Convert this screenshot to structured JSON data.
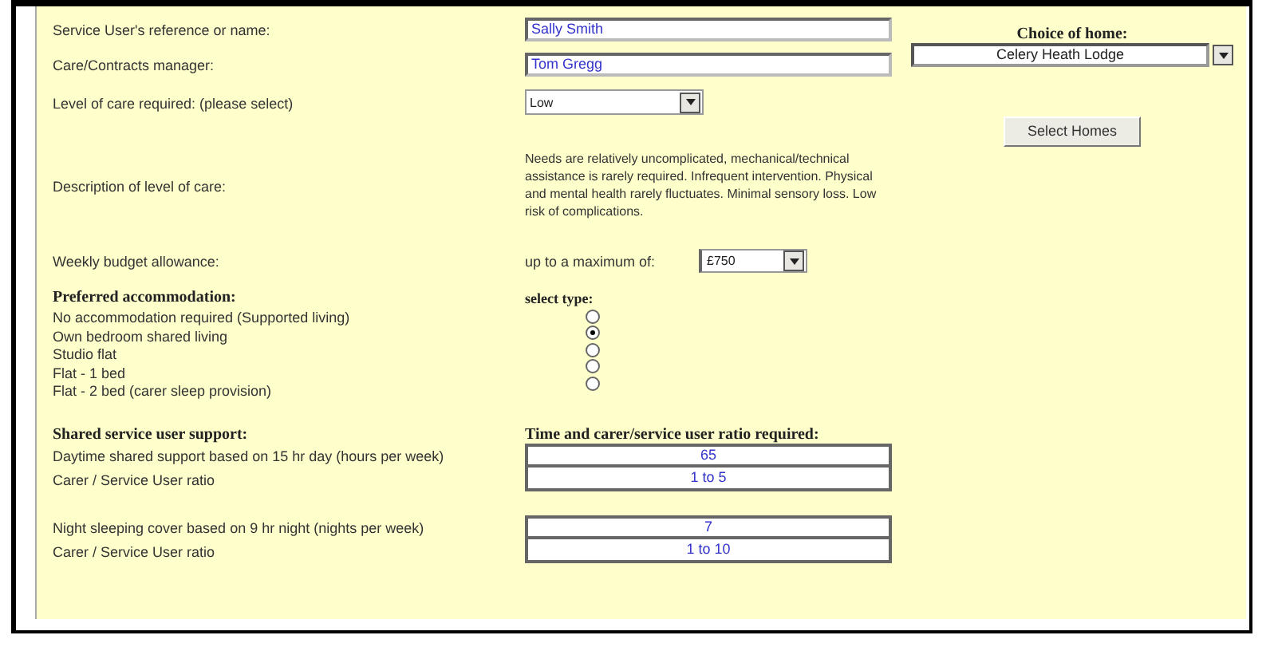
{
  "form": {
    "reference": {
      "label": "Service User's reference or name:",
      "value": "Sally Smith"
    },
    "manager": {
      "label": "Care/Contracts manager:",
      "value": "Tom Gregg"
    },
    "care_level": {
      "label": "Level of care required: (please select)",
      "value": "Low"
    },
    "description": {
      "label": "Description of level of care:",
      "text": "Needs are relatively uncomplicated, mechanical/technical assistance is rarely required. Infrequent intervention. Physical and mental health rarely fluctuates. Minimal sensory loss. Low risk of complications."
    },
    "budget": {
      "label": "Weekly budget allowance:",
      "prefix": "up to a maximum of:",
      "value": "£750"
    }
  },
  "accommodation": {
    "heading": "Preferred accommodation:",
    "select_heading": "select type:",
    "options": [
      {
        "label": "No accommodation required (Supported living)",
        "selected": false
      },
      {
        "label": "Own bedroom shared living",
        "selected": true
      },
      {
        "label": "Studio flat",
        "selected": false
      },
      {
        "label": "Flat - 1 bed",
        "selected": false
      },
      {
        "label": "Flat - 2 bed (carer sleep provision)",
        "selected": false
      }
    ]
  },
  "support": {
    "heading": "Shared service user support:",
    "ratio_heading": "Time and carer/service user ratio required:",
    "groups": [
      [
        {
          "label": "Daytime shared support based on 15 hr day (hours per week)",
          "value": "65"
        },
        {
          "label": "Carer / Service User ratio",
          "value": "1 to 5"
        }
      ],
      [
        {
          "label": "Night sleeping cover based on 9 hr night (nights per week)",
          "value": "7"
        },
        {
          "label": "Carer / Service User ratio",
          "value": "1 to 10"
        }
      ]
    ]
  },
  "home": {
    "label": "Choice of home:",
    "value": "Celery Heath Lodge",
    "button": "Select Homes"
  }
}
